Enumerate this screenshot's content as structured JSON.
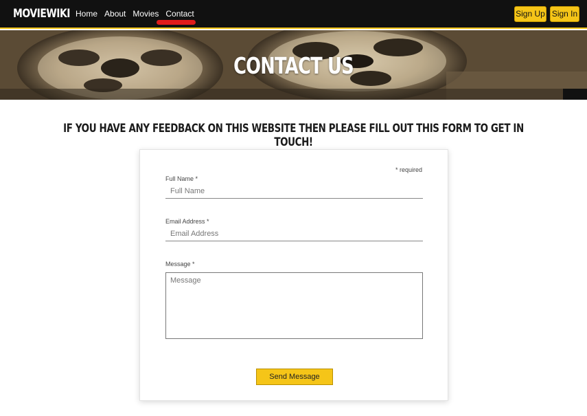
{
  "nav": {
    "brand": "MOVIEWIKI",
    "links": [
      {
        "label": "Home"
      },
      {
        "label": "About"
      },
      {
        "label": "Movies"
      },
      {
        "label": "Contact",
        "active": true
      }
    ],
    "signup_label": "Sign Up",
    "signin_label": "Sign In"
  },
  "hero": {
    "title": "CONTACT US"
  },
  "intro": "IF YOU HAVE ANY FEEDBACK ON THIS WEBSITE THEN PLEASE FILL OUT THIS FORM TO GET IN TOUCH!",
  "form": {
    "required_note": "* required",
    "full_name": {
      "label": "Full Name *",
      "placeholder": "Full Name",
      "value": ""
    },
    "email": {
      "label": "Email Address *",
      "placeholder": "Email Address",
      "value": ""
    },
    "message": {
      "label": "Message *",
      "placeholder": "Message",
      "value": ""
    },
    "submit_label": "Send Message"
  },
  "colors": {
    "accent": "#f5c518",
    "navbar_bg": "#111111",
    "active_underline": "#e01b1b"
  }
}
